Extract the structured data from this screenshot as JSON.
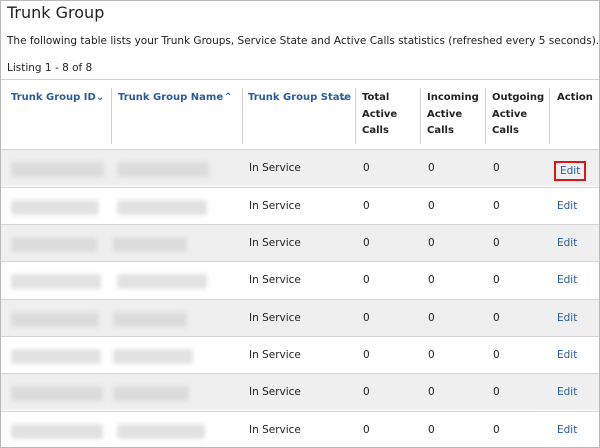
{
  "page": {
    "title": "Trunk Group",
    "description": "The following table lists your Trunk Groups, Service State and Active Calls statistics (refreshed every 5 seconds).",
    "listing": "Listing 1 - 8 of 8"
  },
  "table": {
    "columns": {
      "id": "Trunk Group ID",
      "name": "Trunk Group Name",
      "state": "Trunk Group State",
      "total": [
        "Total",
        "Active",
        "Calls"
      ],
      "incoming": [
        "Incoming",
        "Active",
        "Calls"
      ],
      "outgoing": [
        "Outgoing",
        "Active",
        "Calls"
      ],
      "action": "Action"
    },
    "icons": {
      "id_sort": "chevron-down-icon",
      "name_sort": "chevron-up-icon",
      "state_sort": "chevron-down-icon"
    },
    "rows": [
      {
        "state": "In Service",
        "total": "0",
        "incoming": "0",
        "outgoing": "0",
        "action": "Edit"
      },
      {
        "state": "In Service",
        "total": "0",
        "incoming": "0",
        "outgoing": "0",
        "action": "Edit"
      },
      {
        "state": "In Service",
        "total": "0",
        "incoming": "0",
        "outgoing": "0",
        "action": "Edit"
      },
      {
        "state": "In Service",
        "total": "0",
        "incoming": "0",
        "outgoing": "0",
        "action": "Edit"
      },
      {
        "state": "In Service",
        "total": "0",
        "incoming": "0",
        "outgoing": "0",
        "action": "Edit"
      },
      {
        "state": "In Service",
        "total": "0",
        "incoming": "0",
        "outgoing": "0",
        "action": "Edit"
      },
      {
        "state": "In Service",
        "total": "0",
        "incoming": "0",
        "outgoing": "0",
        "action": "Edit"
      },
      {
        "state": "In Service",
        "total": "0",
        "incoming": "0",
        "outgoing": "0",
        "action": "Edit"
      }
    ]
  },
  "colors": {
    "link": "#2a5d98",
    "highlight_border": "#d8171b",
    "row_shaded": "#efefef"
  }
}
